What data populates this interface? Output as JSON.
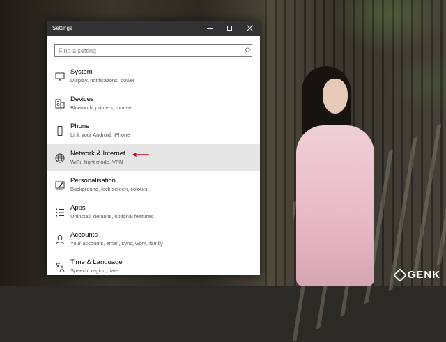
{
  "window": {
    "title": "Settings"
  },
  "search": {
    "placeholder": "Find a setting"
  },
  "items": [
    {
      "name": "System",
      "desc": "Display, notifications, power",
      "icon": "monitor-icon"
    },
    {
      "name": "Devices",
      "desc": "Bluetooth, printers, mouse",
      "icon": "devices-icon"
    },
    {
      "name": "Phone",
      "desc": "Link your Android, iPhone",
      "icon": "phone-icon"
    },
    {
      "name": "Network & Internet",
      "desc": "WiFi, flight mode, VPN",
      "icon": "globe-icon",
      "highlighted": true
    },
    {
      "name": "Personalisation",
      "desc": "Background, lock screen, colours",
      "icon": "paint-icon"
    },
    {
      "name": "Apps",
      "desc": "Uninstall, defaults, optional features",
      "icon": "apps-list-icon"
    },
    {
      "name": "Accounts",
      "desc": "Your accounts, email, sync, work, family",
      "icon": "person-icon"
    },
    {
      "name": "Time & Language",
      "desc": "Speech, region, date",
      "icon": "time-language-icon"
    }
  ],
  "annotation": {
    "color": "#d0021b"
  },
  "watermark": {
    "text": "GENK"
  },
  "colors": {
    "titlebar": "#333333",
    "hover": "#e6e6e6"
  }
}
